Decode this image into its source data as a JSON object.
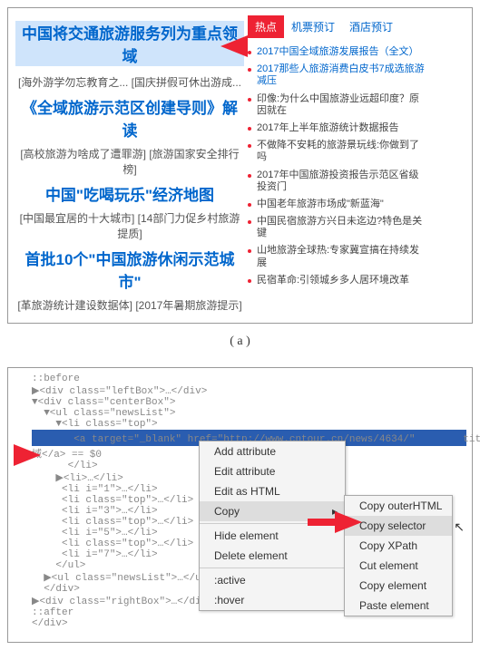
{
  "top": {
    "main_headline": "中国将交通旅游服务列为重点领域",
    "sub1": "[海外游学勿忘教育之... [国庆拼假可休出游成...",
    "hl2": "《全域旅游示范区创建导则》解读",
    "sub2": "[高校旅游为啥成了遭罪游] [旅游国家安全排行榜]",
    "hl3": "中国\"吃喝玩乐\"经济地图",
    "sub3": "[中国最宜居的十大城市] [14部门力促乡村旅游提质]",
    "hl4": "首批10个\"中国旅游休闲示范城市\"",
    "sub4": "[革旅游统计建设数据体] [2017年暑期旅游提示]",
    "tabs": {
      "t1": "热点",
      "t2": "机票预订",
      "t3": "酒店预订"
    },
    "rlist": [
      "2017中国全域旅游发展报告（全文）",
      "2017那些人旅游消费白皮书7成选旅游减压",
      "印像:为什么中国旅游业远超印度？原因就在",
      "2017年上半年旅游统计数据报告",
      "不做降不安耗的旅游景玩线:你做到了吗",
      "2017年中国旅游投资报告示范区省级投资门",
      "中国老年旅游市场成\"新蓝海\"",
      "中国民宿旅游方兴日未迄边?特色是关键",
      "山地旅游全球热:专家冀宣搞在持续发展",
      "民宿革命:引领城乡多人居环境改革"
    ]
  },
  "caption_a": "( a )",
  "dev": {
    "l0": "::before",
    "l1": "▶<div class=\"leftBox\">…</div>",
    "l2": "▼<div class=\"centerBox\">",
    "l3": "  ▼<ul class=\"newsList\">",
    "l4": "    ▼<li class=\"top\">",
    "l5a": "       <a target=\"_blank\" href=\"http://www.cntour.cn/news/4634/\"",
    "l5b": "       title=\"中国将交通旅游服务列为重点领域\">中国将交通旅游服务列为重点领",
    "l5c": "域</a> == $0",
    "l6": "      </li>",
    "l7": "    ▶<li>…</li>",
    "l8": "     <li i=\"1\">…</li>",
    "l9": "     <li class=\"top\">…</li>",
    "l10": "     <li i=\"3\">…</li>",
    "l11": "     <li class=\"top\">…</li>",
    "l12": "     <li i=\"5\">…</li>",
    "l13": "     <li class=\"top\">…</li>",
    "l14": "     <li i=\"7\">…</li>",
    "l15": "    </ul>",
    "l16": "  ▶<ul class=\"newsList\">…</ul>",
    "l17": "  </div>",
    "l18": "▶<div class=\"rightBox\">…</div>",
    "l19": "::after",
    "l20": "</div>"
  },
  "menu": {
    "m1": "Add attribute",
    "m2": "Edit attribute",
    "m3": "Edit as HTML",
    "m4": "Copy",
    "m5": "Hide element",
    "m6": "Delete element",
    "m7": ":active",
    "m8": ":hover",
    "s1": "Copy outerHTML",
    "s2": "Copy selector",
    "s3": "Copy XPath",
    "s4": "Cut element",
    "s5": "Copy element",
    "s6": "Paste element"
  }
}
